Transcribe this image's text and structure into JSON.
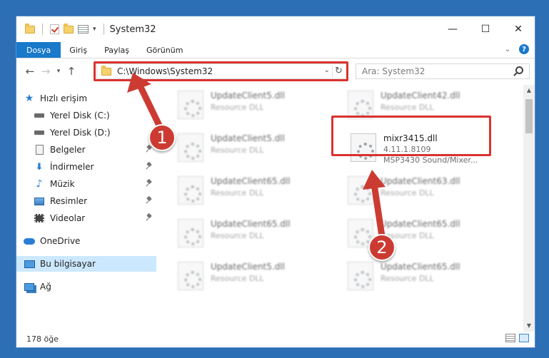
{
  "window": {
    "title": "System32"
  },
  "ribbon": {
    "tabs": [
      {
        "label": "Dosya"
      },
      {
        "label": "Giriş"
      },
      {
        "label": "Paylaş"
      },
      {
        "label": "Görünüm"
      }
    ],
    "help_label": "?"
  },
  "address": {
    "path": "C:\\Windows\\System32"
  },
  "search": {
    "placeholder": "Ara: System32"
  },
  "nav": {
    "quick_access": "Hızlı erişim",
    "items": [
      {
        "label": "Yerel Disk (C:)"
      },
      {
        "label": "Yerel Disk (D:)"
      },
      {
        "label": "Belgeler"
      },
      {
        "label": "İndirmeler"
      },
      {
        "label": "Müzik"
      },
      {
        "label": "Resimler"
      },
      {
        "label": "Videolar"
      }
    ],
    "onedrive": "OneDrive",
    "this_pc": "Bu bilgisayar",
    "network": "Ağ"
  },
  "files": {
    "blurred": [
      {
        "name": "UpdateClient5.dll",
        "type": "Resource DLL"
      },
      {
        "name": "UpdateClient42.dll",
        "type": "Resource DLL"
      },
      {
        "name": "UpdateClient5.dll",
        "type": "Resource DLL"
      },
      {
        "name": "UpdateClient65.dll",
        "type": "Resource DLL"
      },
      {
        "name": "UpdateClient63.dll",
        "type": "Resource DLL"
      },
      {
        "name": "UpdateClient65.dll",
        "type": "Resource DLL"
      },
      {
        "name": "UpdateClient65.dll",
        "type": "Resource DLL"
      },
      {
        "name": "UpdateClient5.dll",
        "type": "Resource DLL"
      },
      {
        "name": "UpdateClient65.dll",
        "type": "Resource DLL"
      }
    ],
    "highlighted": {
      "name": "mixr3415.dll",
      "version": "4.11.1.8109",
      "description": "MSP3430 Sound/Mixer..."
    }
  },
  "status": {
    "count": "178 öğe"
  },
  "annotations": {
    "step1": "1",
    "step2": "2",
    "color": "#cc3b32"
  }
}
